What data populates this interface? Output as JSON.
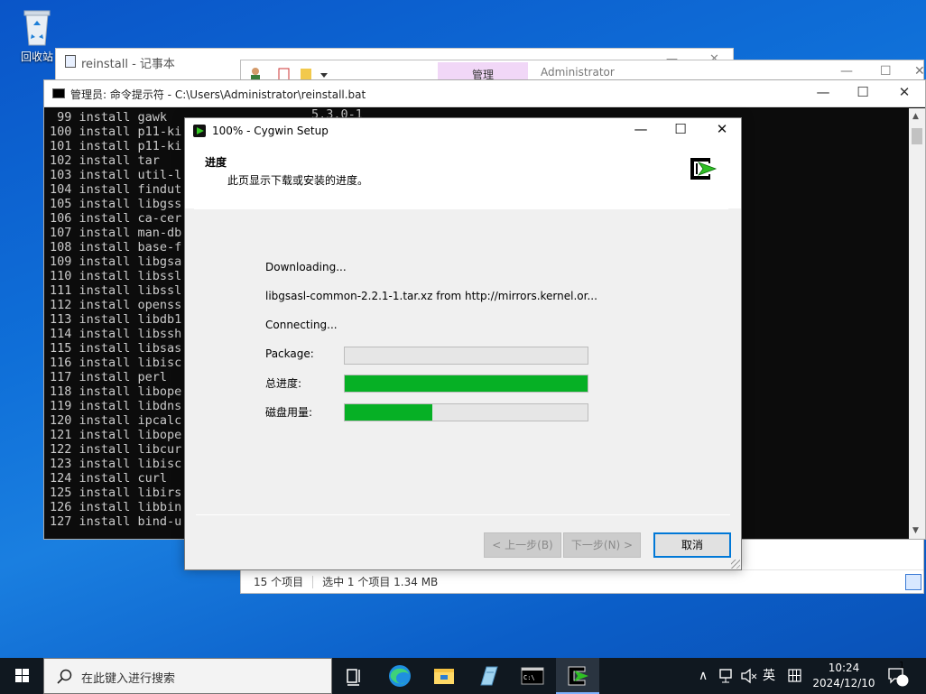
{
  "desktop": {
    "recycle_bin_label": "回收站"
  },
  "notepad": {
    "title": "reinstall - 记事本"
  },
  "explorer": {
    "ribbon_tab": "管理",
    "location": "Administrator",
    "status_items": "15 个项目",
    "status_selected": "选中 1 个项目  1.34 MB"
  },
  "cmd": {
    "title": "管理员: 命令提示符 - C:\\Users\\Administrator\\reinstall.bat",
    "lines": [
      " 99 install gawk",
      "100 install p11-ki",
      "101 install p11-ki",
      "102 install tar",
      "103 install util-l",
      "104 install findut",
      "105 install libgss",
      "106 install ca-cer",
      "107 install man-db",
      "108 install base-f",
      "109 install libgsa",
      "110 install libssl",
      "111 install libssl",
      "112 install openss",
      "113 install libdb1",
      "114 install libssh",
      "115 install libsas",
      "116 install libisc",
      "117 install perl",
      "118 install libope",
      "119 install libdns",
      "120 install ipcalc",
      "121 install libope",
      "122 install libcur",
      "123 install libisc",
      "124 install curl",
      "125 install libirs",
      "126 install libbin",
      "127 install bind-u"
    ],
    "overflow_text": "5.3.0-1"
  },
  "cygwin": {
    "title": "100% - Cygwin Setup",
    "heading": "进度",
    "subheading": "此页显示下载或安装的进度。",
    "status_line1": "Downloading...",
    "status_line2": "libgsasl-common-2.2.1-1.tar.xz from http://mirrors.kernel.or...",
    "status_line3": "Connecting...",
    "package_label": "Package:",
    "total_label": "总进度:",
    "disk_label": "磁盘用量:",
    "progress": {
      "package": 0,
      "total": 1.0,
      "disk": 0.36
    },
    "buttons": {
      "back": "< 上一步(B)",
      "next": "下一步(N) >",
      "cancel": "取消"
    }
  },
  "taskbar": {
    "search_placeholder": "在此键入进行搜索",
    "ime": "英",
    "time": "10:24",
    "date": "2024/12/10",
    "notifications": "1"
  },
  "colors": {
    "progress_green": "#06b025",
    "accent": "#0078d7"
  }
}
